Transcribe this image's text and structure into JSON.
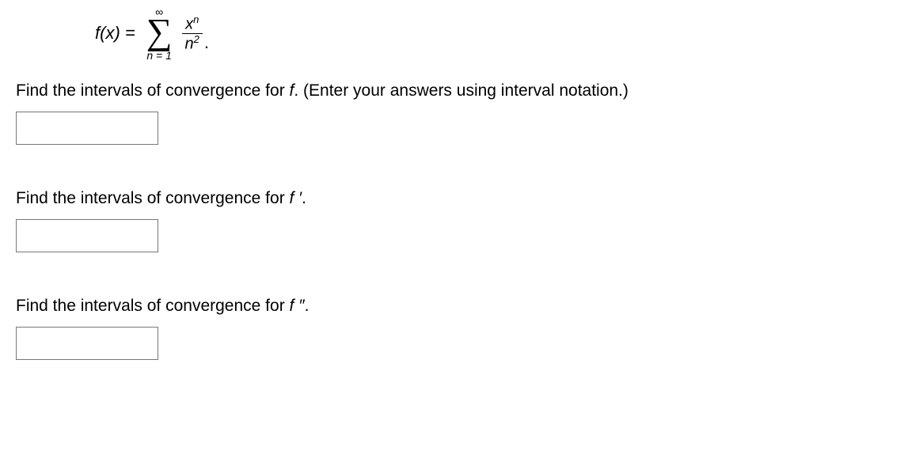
{
  "formula": {
    "lhs": "f(x) =",
    "sum_upper": "∞",
    "sum_lower": "n = 1",
    "frac_num_base": "x",
    "frac_num_exp": "n",
    "frac_den_base": "n",
    "frac_den_exp": "2",
    "terminator": "."
  },
  "questions": {
    "q1_pre": "Find the intervals of convergence for ",
    "q1_var": "f",
    "q1_post": ". (Enter your answers using interval notation.)",
    "q2_pre": "Find the intervals of convergence for ",
    "q2_var": "f ′",
    "q2_post": ".",
    "q3_pre": "Find the intervals of convergence for ",
    "q3_var": "f ″",
    "q3_post": "."
  },
  "answers": {
    "a1": "",
    "a2": "",
    "a3": ""
  }
}
